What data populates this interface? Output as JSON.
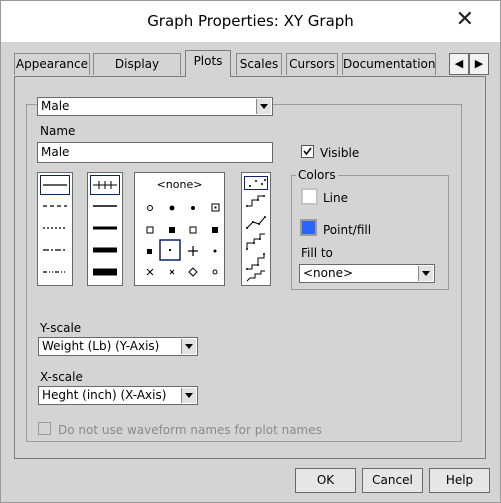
{
  "window": {
    "title": "Graph Properties: XY Graph"
  },
  "tabs": [
    {
      "label": "Appearance"
    },
    {
      "label": "Display Format"
    },
    {
      "label": "Plots",
      "active": true
    },
    {
      "label": "Scales"
    },
    {
      "label": "Cursors"
    },
    {
      "label": "Documentation"
    }
  ],
  "tab_nav": {
    "prev_icon": "◀",
    "next_icon": "▶"
  },
  "plot_selector": {
    "value": "Male"
  },
  "name": {
    "label": "Name",
    "value": "Male"
  },
  "visible": {
    "label": "Visible",
    "checked": true
  },
  "point_style": {
    "none_label": "<none>"
  },
  "colors": {
    "title": "Colors",
    "line_label": "Line",
    "line_color": "#ffffff",
    "point_label": "Point/fill",
    "point_color": "#2a64ff",
    "fill_label": "Fill to",
    "fill_value": "<none>"
  },
  "y_scale": {
    "label": "Y-scale",
    "value": "Weight (Lb) (Y-Axis)"
  },
  "x_scale": {
    "label": "X-scale",
    "value": "Heght (inch) (X-Axis)"
  },
  "waveform_option": {
    "label": "Do not use waveform names for plot names",
    "checked": false
  },
  "buttons": {
    "ok": "OK",
    "cancel": "Cancel",
    "help": "Help"
  }
}
